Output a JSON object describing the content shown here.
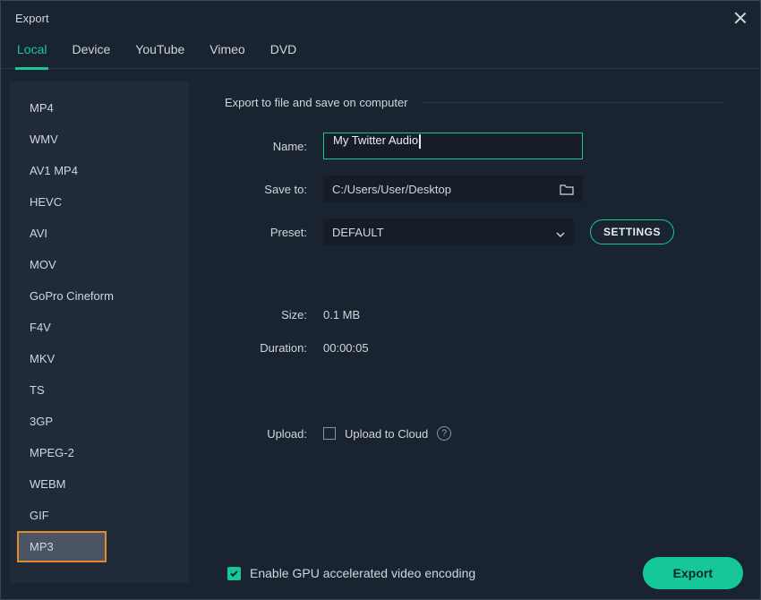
{
  "window": {
    "title": "Export"
  },
  "tabs": {
    "items": [
      {
        "label": "Local",
        "active": true
      },
      {
        "label": "Device"
      },
      {
        "label": "YouTube"
      },
      {
        "label": "Vimeo"
      },
      {
        "label": "DVD"
      }
    ]
  },
  "formats": {
    "items": [
      "MP4",
      "WMV",
      "AV1 MP4",
      "HEVC",
      "AVI",
      "MOV",
      "GoPro Cineform",
      "F4V",
      "MKV",
      "TS",
      "3GP",
      "MPEG-2",
      "WEBM",
      "GIF",
      "MP3"
    ],
    "selected": "MP3"
  },
  "main": {
    "section_heading": "Export to file and save on computer",
    "name_label": "Name:",
    "name_value": "My Twitter Audio",
    "save_label": "Save to:",
    "save_value": "C:/Users/User/Desktop",
    "preset_label": "Preset:",
    "preset_value": "DEFAULT",
    "settings_btn": "SETTINGS",
    "size_label": "Size:",
    "size_value": "0.1 MB",
    "duration_label": "Duration:",
    "duration_value": "00:00:05",
    "upload_label": "Upload:",
    "upload_text": "Upload to Cloud",
    "upload_checked": false
  },
  "footer": {
    "gpu_label": "Enable GPU accelerated video encoding",
    "gpu_checked": true,
    "export_btn": "Export"
  }
}
